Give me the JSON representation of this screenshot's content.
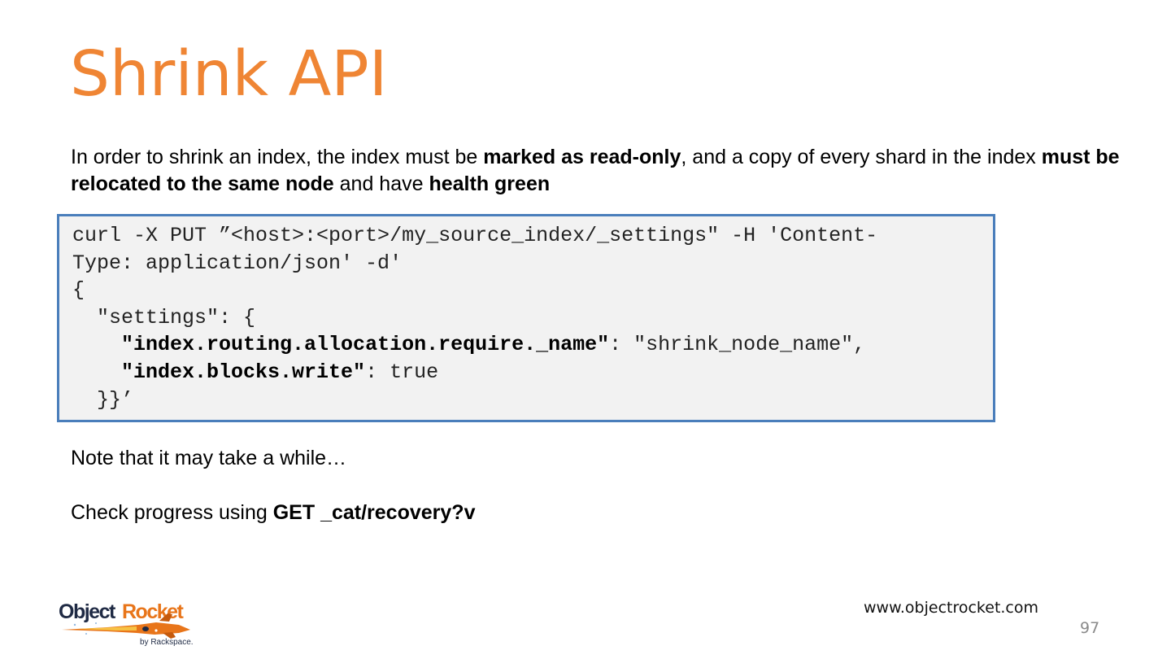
{
  "slide": {
    "title": "Shrink API",
    "intro": {
      "t1": "In order to shrink an index, the index must be ",
      "b1": "marked as read-only",
      "t2": ", and a copy of every shard in the index ",
      "b2": "must be relocated to the same node",
      "t3": " and have ",
      "b3": "health green"
    },
    "code": {
      "line1": "curl -X PUT ”<host>:<port>/my_source_index/_settings\" -H 'Content-",
      "line2": "Type: application/json' -d'",
      "line3": "{",
      "line4": "  \"settings\": {",
      "line5_indent": "    ",
      "line5_key": "\"index.routing.allocation.require._name\"",
      "line5_rest": ": \"shrink_node_name\",",
      "line6_indent": "    ",
      "line6_key": "\"index.blocks.write\"",
      "line6_rest": ": true",
      "line7": "  }}’"
    },
    "note": "Note that it may take a while…",
    "check": {
      "text": "Check progress using ",
      "bold": "GET _cat/recovery?v"
    }
  },
  "footer": {
    "logo_text_object": "Object",
    "logo_text_rocket": "Rocket",
    "logo_tagline": "by Rackspace.",
    "url": "www.objectrocket.com",
    "page_number": "97"
  },
  "colors": {
    "title": "#ef8534",
    "code_border": "#4a7ebb",
    "code_bg": "#f2f2f2",
    "logo_dark": "#1f2a44",
    "logo_orange": "#e8751a"
  }
}
